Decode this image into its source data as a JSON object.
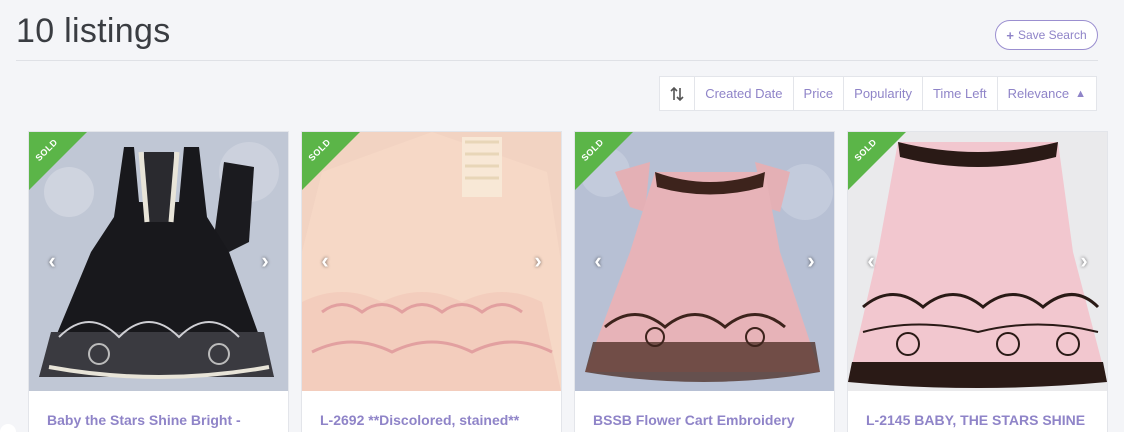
{
  "header": {
    "title": "10 listings",
    "save_search": "Save Search"
  },
  "sort": {
    "options": [
      "Created Date",
      "Price",
      "Popularity",
      "Time Left",
      "Relevance"
    ],
    "active": "Relevance",
    "active_arrow": "▲"
  },
  "listings": [
    {
      "badge": "SOLD",
      "title": "Baby the Stars Shine Bright -",
      "image": "black-jumper-dress-icon"
    },
    {
      "badge": "SOLD",
      "title": "L-2692 **Discolored, stained**",
      "image": "peach-dress-icon"
    },
    {
      "badge": "SOLD",
      "title": "BSSB Flower Cart Embroidery",
      "image": "pink-dress-with-brown-trim-icon"
    },
    {
      "badge": "SOLD",
      "title": "L-2145 BABY, THE STARS SHINE",
      "image": "pink-dress-with-black-print-icon"
    }
  ],
  "colors": {
    "accent": "#8f84c8",
    "sold_badge": "#5bb548",
    "background": "#f4f5f8"
  }
}
